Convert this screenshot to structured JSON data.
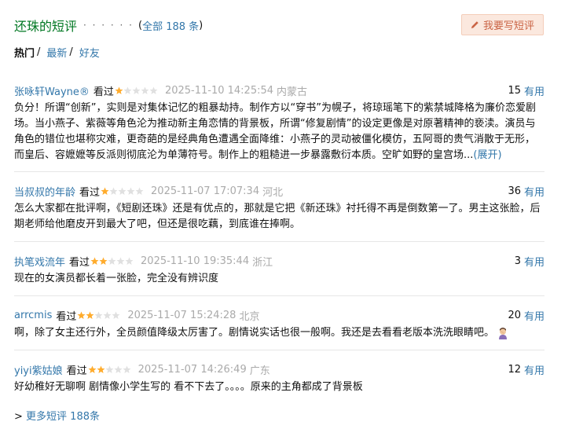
{
  "header": {
    "title": "还珠的短评",
    "dots": "· · · · · ·",
    "total_open": "( ",
    "total_label": "全部 188 条",
    "total_close": " )",
    "write_label": "我要写短评"
  },
  "tabs": [
    {
      "label": "热门",
      "active": true
    },
    {
      "label": "最新",
      "active": false
    },
    {
      "label": "好友",
      "active": false
    }
  ],
  "tab_separator": "/",
  "colors": {
    "accent": "#3377aa",
    "title": "#007722",
    "star": "#ffac2d",
    "star_empty": "#e0e0e0"
  },
  "reviews": [
    {
      "author": "张咏轩Wayne®",
      "watched": "看过",
      "rating": 1,
      "time": "2025-11-10 14:25:54",
      "location": "内蒙古",
      "votes": "15",
      "useful": "有用",
      "text": "负分！所谓“创新”，实则是对集体记忆的粗暴劫持。制作方以“穿书”为幌子，将琼瑶笔下的紫禁城降格为廉价恋爱剧场。当小燕子、紫薇等角色沦为推动新主角恋情的背景板，所谓“修复剧情”的设定更像是对原著精神的亵渎。演员与角色的错位也堪称灾难，更奇葩的是经典角色遭遇全面降维：小燕子的灵动被僵化模仿，五阿哥的贵气消散于无形，而皇后、容嬷嬷等反派则彻底沦为单薄符号。制作上的粗糙进一步暴露敷衍本质。空旷如野的皇宫场...",
      "expand": "(展开)"
    },
    {
      "author": "当叔叔的年龄",
      "watched": "看过",
      "rating": 1,
      "time": "2025-11-07 17:07:34",
      "location": "河北",
      "votes": "36",
      "useful": "有用",
      "text": "怎么大家都在批评啊，《短剧还珠》还是有优点的，那就是它把《新还珠》衬托得不再是倒数第一了。男主这张脸，后期老师给他磨皮开到最大了吧，但还是很吃藕，到底谁在捧啊。"
    },
    {
      "author": "执笔戏流年",
      "watched": "看过",
      "rating": 2,
      "time": "2025-11-10 19:35:44",
      "location": "浙江",
      "votes": "3",
      "useful": "有用",
      "text": "现在的女演员都长着一张脸，完全没有辨识度"
    },
    {
      "author": "arrcmis",
      "watched": "看过",
      "rating": 2,
      "time": "2025-11-07 15:24:28",
      "location": "北京",
      "votes": "20",
      "useful": "有用",
      "text": "啊，除了女主还行外，全员颜值降级太厉害了。剧情说实话也很一般啊。我还是去看看老版本洗洗眼睛吧。",
      "emoji": "person-facepalm-emoji"
    },
    {
      "author": "yiyi紫姑娘",
      "watched": "看过",
      "rating": 2,
      "time": "2025-11-07 14:26:49",
      "location": "广东",
      "votes": "12",
      "useful": "有用",
      "text": "好幼稚好无聊啊 剧情像小学生写的 看不下去了。。。。原来的主角都成了背景板"
    }
  ],
  "more": {
    "arrow": ">",
    "label": "更多短评 188条"
  }
}
